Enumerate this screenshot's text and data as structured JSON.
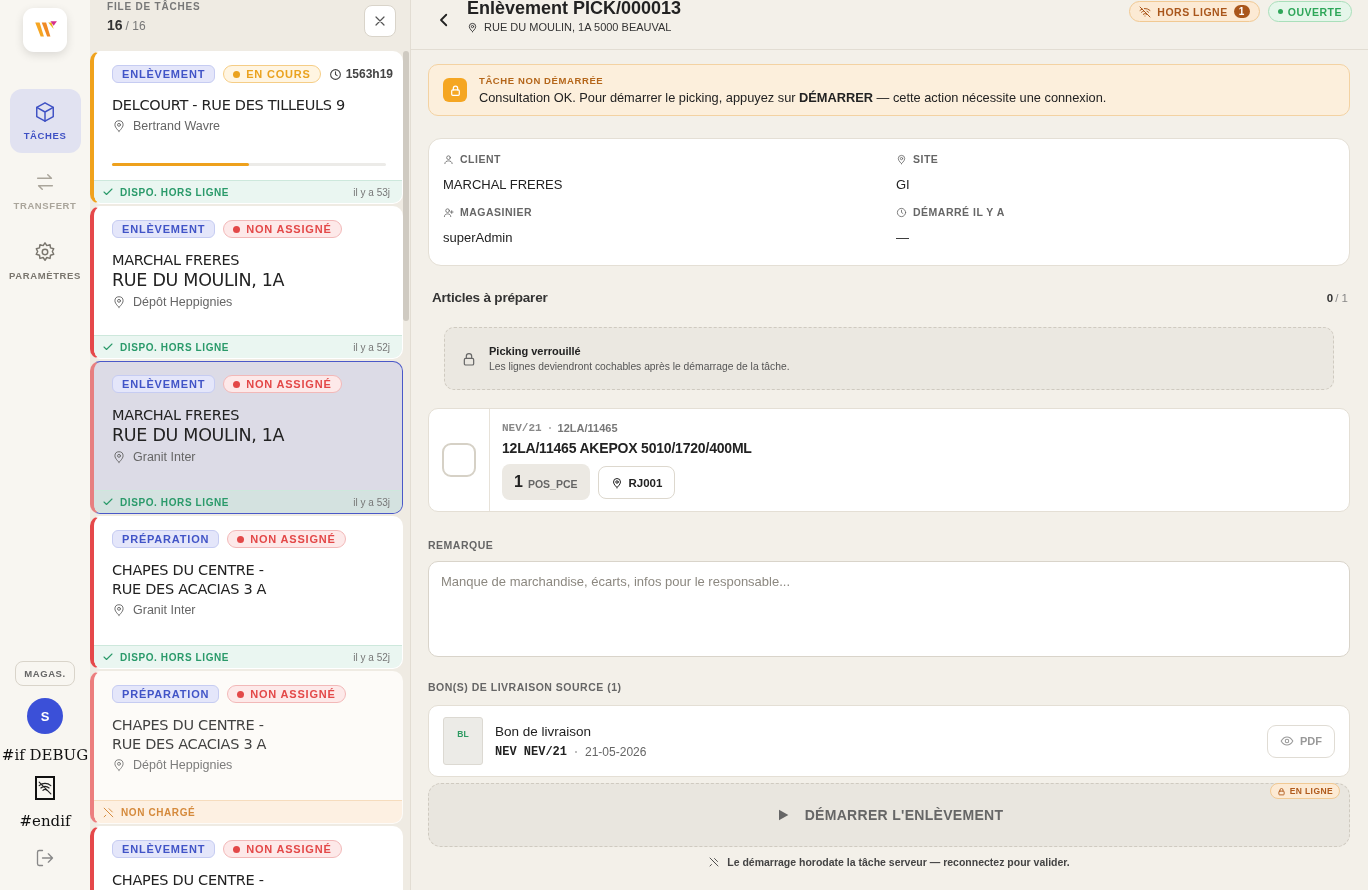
{
  "rail": {
    "nav": [
      {
        "label": "TÂCHES",
        "selected": true,
        "disabled": false
      },
      {
        "label": "TRANSFERT",
        "selected": false,
        "disabled": true
      },
      {
        "label": "PARAMÈTRES",
        "selected": false,
        "disabled": false
      }
    ],
    "role_button": "MAGAS.",
    "avatar": "S",
    "debug_open": "#if DEBUG",
    "debug_close": "#endif"
  },
  "queue": {
    "title": "FILE DE TÂCHES",
    "count": "16",
    "total": "/ 16",
    "cards": [
      {
        "type": "ENLÈVEMENT",
        "status": {
          "kind": "in_progress",
          "label": "EN COURS"
        },
        "duration": "1563h19",
        "lines": [
          {
            "kind": "normal",
            "text": "DELCOURT - RUE DES TILLEULS 9"
          }
        ],
        "location": "Bertrand Wavre",
        "level": 0.5,
        "footer": {
          "kind": "offline_ready",
          "label": "DISPO. HORS LIGNE",
          "age": "il y a 53j"
        },
        "selected": false
      },
      {
        "type": "ENLÈVEMENT",
        "status": {
          "kind": "unassigned",
          "label": "NON ASSIGNÉ"
        },
        "lines": [
          {
            "kind": "normal",
            "text": "MARCHAL FRERES"
          },
          {
            "kind": "large",
            "text": "RUE DU MOULIN, 1A"
          }
        ],
        "location": "Dépôt Heppignies",
        "footer": {
          "kind": "offline_ready",
          "label": "DISPO. HORS LIGNE",
          "age": "il y a 52j"
        },
        "selected": false
      },
      {
        "type": "ENLÈVEMENT",
        "status": {
          "kind": "unassigned",
          "label": "NON ASSIGNÉ"
        },
        "lines": [
          {
            "kind": "normal",
            "text": "MARCHAL FRERES"
          },
          {
            "kind": "large",
            "text": "RUE DU MOULIN, 1A"
          }
        ],
        "location": "Granit Inter",
        "footer": {
          "kind": "offline_ready",
          "label": "DISPO. HORS LIGNE",
          "age": "il y a 53j"
        },
        "selected": true
      },
      {
        "type": "PRÉPARATION",
        "status": {
          "kind": "unassigned",
          "label": "NON ASSIGNÉ"
        },
        "lines": [
          {
            "kind": "normal",
            "text": "CHAPES DU CENTRE -"
          },
          {
            "kind": "normal",
            "text": "RUE DES ACACIAS 3 A"
          }
        ],
        "location": "Granit Inter",
        "footer": {
          "kind": "offline_ready",
          "label": "DISPO. HORS LIGNE",
          "age": "il y a 52j"
        },
        "selected": false
      },
      {
        "type": "PRÉPARATION",
        "status": {
          "kind": "unassigned",
          "label": "NON ASSIGNÉ"
        },
        "lines": [
          {
            "kind": "normal",
            "text": "CHAPES DU CENTRE -"
          },
          {
            "kind": "normal",
            "text": "RUE DES ACACIAS 3 A"
          }
        ],
        "location": "Dépôt Heppignies",
        "footer": {
          "kind": "not_loaded",
          "label": "NON CHARGÉ"
        },
        "selected": false
      },
      {
        "type": "ENLÈVEMENT",
        "status": {
          "kind": "unassigned",
          "label": "NON ASSIGNÉ"
        },
        "lines": [
          {
            "kind": "normal",
            "text": "CHAPES DU CENTRE -"
          }
        ],
        "selected": false
      }
    ]
  },
  "detail": {
    "header": {
      "title": "Enlèvement PICK/000013",
      "address": "RUE DU MOULIN, 1A 5000 BEAUVAL",
      "offline": {
        "label": "HORS LIGNE",
        "count": "1"
      },
      "state": "OUVERTE"
    },
    "notice": {
      "title": "TÂCHE NON DÉMARRÉE",
      "text": "Consultation OK. Pour démarrer le picking, appuyez sur **DÉMARRER** — cette action nécessite une connexion."
    },
    "info": [
      {
        "label": "CLIENT",
        "value": "MARCHAL FRERES"
      },
      {
        "label": "SITE",
        "value": "GI"
      },
      {
        "label": "MAGASINIER",
        "value": "superAdmin"
      },
      {
        "label": "DÉMARRÉ IL Y A",
        "value": "—"
      }
    ],
    "articles": {
      "title": "Articles à préparer",
      "done": "0",
      "total": "/ 1",
      "lock": {
        "title": "Picking verrouillé",
        "text": "Les lignes deviendront cochables après le démarrage de la tâche."
      },
      "items": [
        {
          "ref": "NEV/21",
          "code": "12LA/11465",
          "name": "12LA/11465 AKEPOX 5010/1720/400ML",
          "qty": "1",
          "unit": "POS_PCE",
          "location": "RJ001",
          "checked": false
        }
      ]
    },
    "remark": {
      "label": "REMARQUE",
      "placeholder": "Manque de marchandise, écarts, infos pour le responsable..."
    },
    "documents": {
      "label": "BON(S) DE LIVRAISON SOURCE (1)",
      "items": [
        {
          "badge": "BL",
          "title": "Bon de livraison",
          "ref": "NEV NEV/21",
          "date": "21-05-2026",
          "action": "PDF"
        }
      ]
    },
    "start": {
      "label": "DÉMARRER L'ENLÈVEMENT",
      "badge": "EN LIGNE",
      "disabled": true
    },
    "note": "Le démarrage horodate la tâche serveur — reconnectez pour valider."
  }
}
